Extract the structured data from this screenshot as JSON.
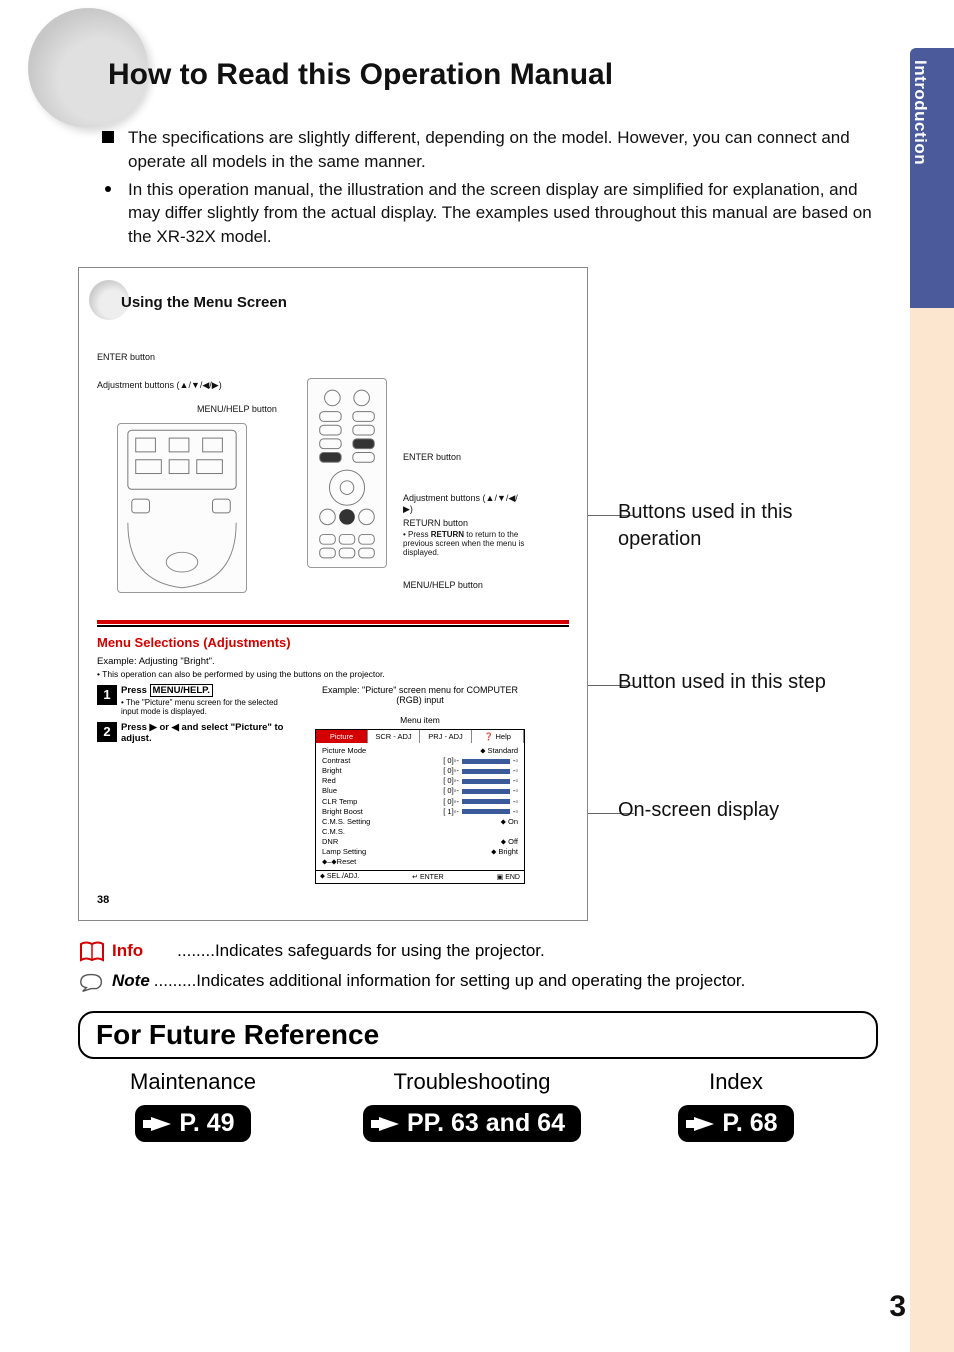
{
  "tab": {
    "label": "Introduction"
  },
  "title": "How to Read this Operation Manual",
  "intro": {
    "item1": "The specifications are slightly different, depending on the model. However, you can connect and operate all models in the same manner.",
    "item2": "In this operation manual, the illustration and the screen display are simplified for explanation, and may differ slightly from the actual display. The examples used throughout this manual are based on the XR-32X model."
  },
  "example": {
    "title": "Using the Menu Screen",
    "labels": {
      "enter_btn_top": "ENTER button",
      "adj_btns_top": "Adjustment buttons (▲/▼/◀/▶)",
      "menu_help_top": "MENU/HELP button",
      "enter_btn_r": "ENTER button",
      "adj_btns_r": "Adjustment buttons (▲/▼/◀/▶)",
      "return_btn": "RETURN button",
      "return_note1": "• Press ",
      "return_note_bold": "RETURN",
      "return_note2": " to return to the previous screen when the menu is displayed.",
      "menu_help_r": "MENU/HELP button"
    },
    "adjustments": {
      "heading": "Menu Selections (Adjustments)",
      "example_line": "Example: Adjusting \"Bright\".",
      "note_line": "• This operation can also be performed by using the buttons on the projector.",
      "step1_text": "Press ",
      "step1_boxed": "MENU/HELP.",
      "step1_sub": "• The \"Picture\" menu screen for the selected input mode is displayed.",
      "step2_text": "Press ▶ or ◀ and select \"Picture\" to adjust.",
      "menu_caption": "Example: \"Picture\" screen menu for COMPUTER (RGB) input",
      "menu_item_label": "Menu item",
      "tabs": {
        "picture": "Picture",
        "scr": "SCR - ADJ",
        "prj": "PRJ - ADJ",
        "help": "Help"
      },
      "rows": {
        "picture_mode": "Picture Mode",
        "picture_mode_val": "Standard",
        "contrast": "Contrast",
        "bright": "Bright",
        "red": "Red",
        "blue": "Blue",
        "clr_temp": "CLR Temp",
        "bright_boost": "Bright Boost",
        "cms_setting": "C.M.S. Setting",
        "cms_setting_val": "On",
        "cms": "C.M.S.",
        "dnr": "DNR",
        "dnr_val": "Off",
        "lamp": "Lamp Setting",
        "lamp_val": "Bright",
        "reset": "Reset",
        "v0": "0",
        "v1": "1"
      },
      "footer": {
        "sel": "SEL./ADJ.",
        "enter": "ENTER",
        "end": "END"
      }
    },
    "page_ref": "38"
  },
  "callouts": {
    "c1": "Buttons used in this operation",
    "c2": "Button used in this step",
    "c3": "On-screen display"
  },
  "legend": {
    "info_label": "Info",
    "info_text": "........Indicates safeguards for using the projector.",
    "note_label": "Note",
    "note_text": ".........Indicates additional information for setting up and operating the projector."
  },
  "future": {
    "heading": "For Future Reference",
    "maintenance": {
      "label": "Maintenance",
      "page": "P. 49"
    },
    "troubleshooting": {
      "label": "Troubleshooting",
      "page": "PP. 63 and 64"
    },
    "index": {
      "label": "Index",
      "page": "P. 68"
    }
  },
  "page_number": "3"
}
